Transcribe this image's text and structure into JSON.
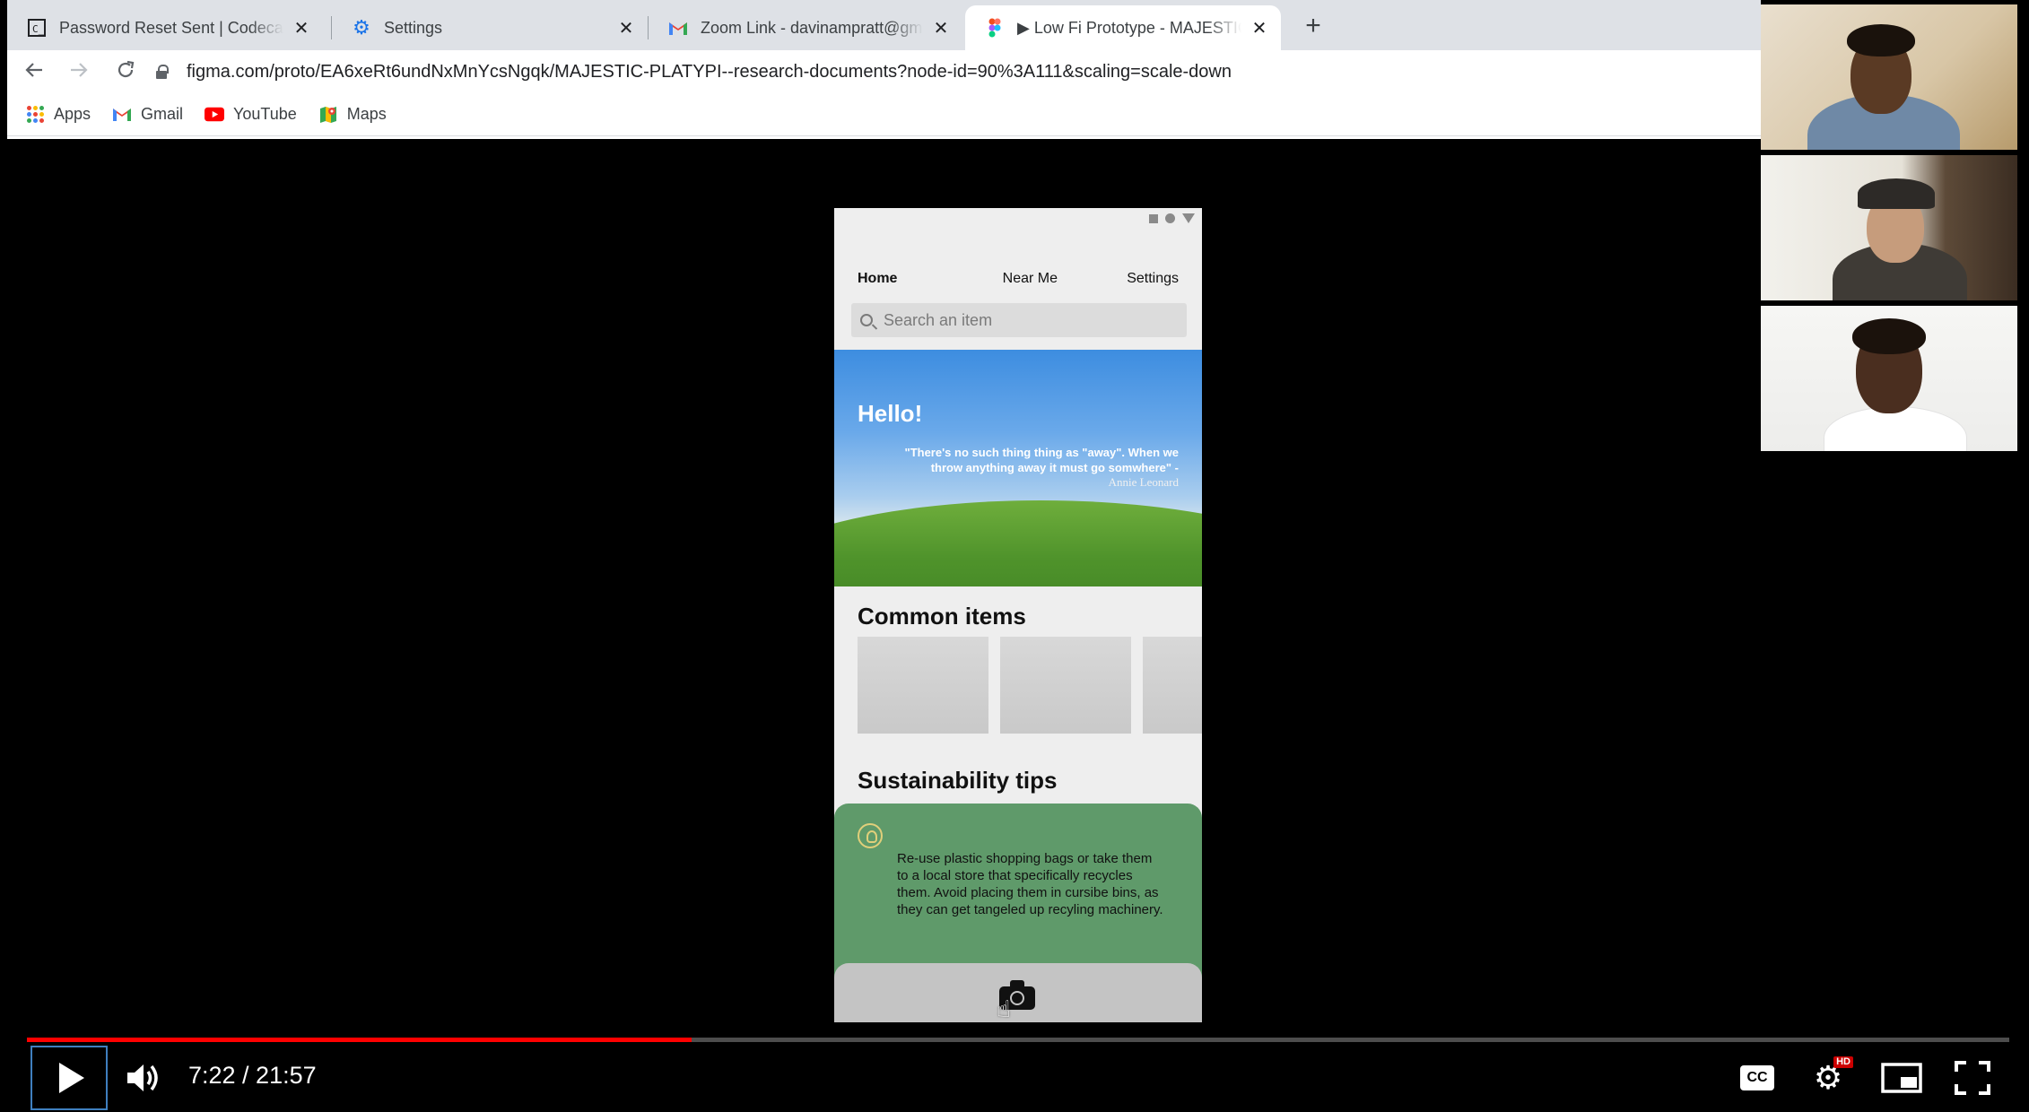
{
  "browser": {
    "tabs": [
      {
        "title": "Password Reset Sent | Codecade",
        "favicon": "codecademy-icon",
        "active": false
      },
      {
        "title": "Settings",
        "favicon": "gear-icon",
        "active": false
      },
      {
        "title": "Zoom Link - davinampratt@gma",
        "favicon": "gmail-icon",
        "active": false
      },
      {
        "title": "▶ Low Fi Prototype - MAJESTIC P",
        "favicon": "figma-icon",
        "active": true
      }
    ],
    "new_tab": "+",
    "url": "figma.com/proto/EA6xeRt6undNxMnYcsNgqk/MAJESTIC-PLATYPI--research-documents?node-id=90%3A111&scaling=scale-down",
    "bookmarks": [
      {
        "label": "Apps",
        "icon": "apps-grid-icon"
      },
      {
        "label": "Gmail",
        "icon": "gmail-icon"
      },
      {
        "label": "YouTube",
        "icon": "youtube-icon"
      },
      {
        "label": "Maps",
        "icon": "maps-icon"
      }
    ]
  },
  "prototype": {
    "nav": {
      "home": "Home",
      "near_me": "Near Me",
      "settings": "Settings"
    },
    "search_placeholder": "Search an item",
    "hero": {
      "greeting": "Hello!",
      "quote": "\"There's no such thing thing as \"away\". When we throw anything away it must go somwhere\" -",
      "author": "Annie Leonard"
    },
    "common_items_title": "Common items",
    "sustainability_title": "Sustainability tips",
    "tip_text": "Re-use plastic shopping bags or take them to a local store that specifically recycles them. Avoid placing them in cursibe bins, as they can get tangeled up recyling machinery.",
    "colors": {
      "tip_card": "#5f9a6a",
      "hero_sky": "#3d8de0",
      "hill": "#4f932b"
    }
  },
  "player": {
    "current_time": "7:22",
    "duration": "21:57",
    "time_display": "7:22 / 21:57",
    "progress_fraction": 0.3355,
    "cc_label": "CC",
    "hd_badge": "HD",
    "accent_color": "#ff0000"
  }
}
